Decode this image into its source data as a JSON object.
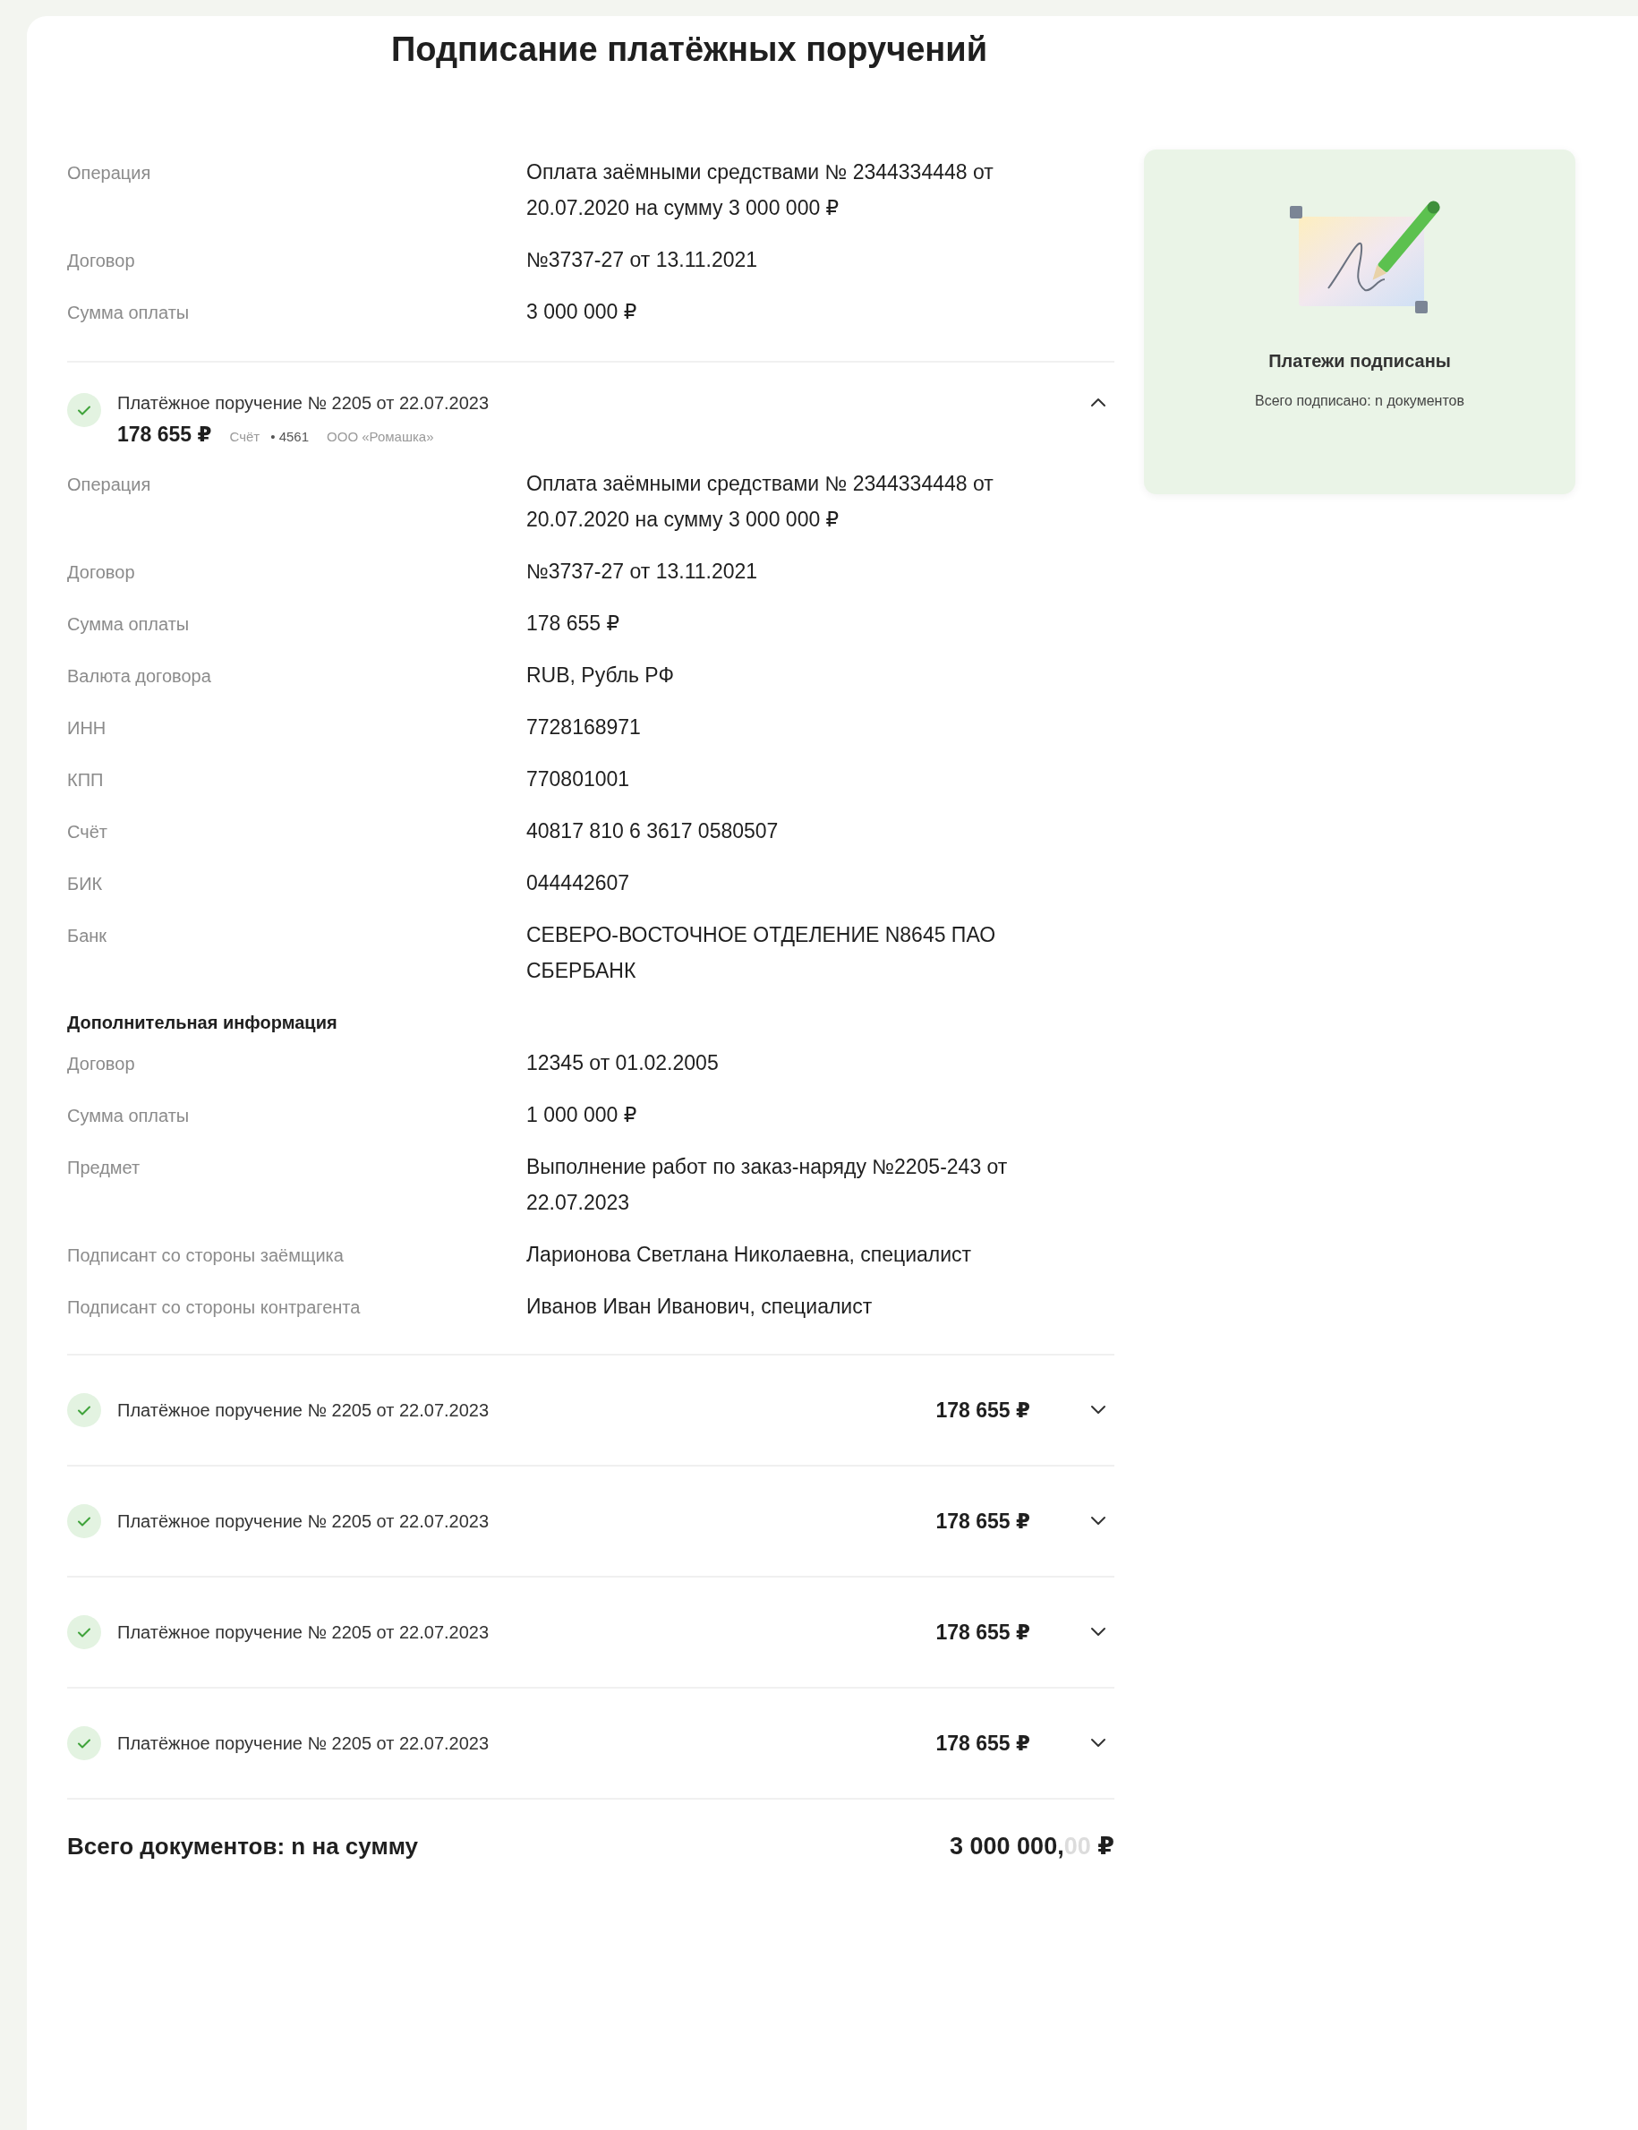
{
  "title": "Подписание платёжных поручений",
  "summary_fields": [
    {
      "label": "Операция",
      "value": "Оплата заёмными средствами № 2344334448 от 20.07.2020 на сумму 3 000 000 ₽"
    },
    {
      "label": "Договор",
      "value": "№3737-27 от 13.11.2021"
    },
    {
      "label": "Сумма оплаты",
      "value": "3 000 000 ₽"
    }
  ],
  "payments": [
    {
      "title": "Платёжное поручение № 2205 от 22.07.2023",
      "amount": "178 655 ₽",
      "signed": true,
      "expanded": true,
      "account": "Счёт",
      "account_number": "• 4561",
      "counterparty": "ООО «Ромашка»",
      "fields": [
        {
          "label": "Операция",
          "value": "Оплата заёмными средствами № 2344334448 от 20.07.2020 на сумму 3 000 000 ₽"
        },
        {
          "label": "Договор",
          "value": "№3737-27 от 13.11.2021"
        },
        {
          "label": "Сумма оплаты",
          "value": "178 655 ₽"
        },
        {
          "label": "Валюта договора",
          "value": "RUB, Рубль РФ"
        },
        {
          "label": "ИНН",
          "value": "7728168971"
        },
        {
          "label": "КПП",
          "value": "770801001"
        },
        {
          "label": "Счёт",
          "value": "40817 810 6 3617 0580507"
        },
        {
          "label": "БИК",
          "value": "044442607"
        },
        {
          "label": "Банк",
          "value": "СЕВЕРО-ВОСТОЧНОЕ ОТДЕЛЕНИЕ N8645 ПАО СБЕРБАНК"
        }
      ],
      "additional": {
        "title": "Дополнительная информация",
        "fields": [
          {
            "label": "Договор",
            "value": "12345 от 01.02.2005"
          },
          {
            "label": "Сумма оплаты",
            "value": "1 000 000 ₽"
          },
          {
            "label": "Предмет",
            "value": "Выполнение работ по заказ-наряду №2205-243 от 22.07.2023"
          },
          {
            "label": "Подписант со стороны заёмщика",
            "value": "Ларионова Светлана Николаевна, специалист"
          },
          {
            "label": "Подписант со стороны контрагента",
            "value": "Иванов Иван Иванович, специалист"
          }
        ]
      }
    },
    {
      "title": "Платёжное поручение № 2205 от 22.07.2023",
      "amount": "178 655 ₽",
      "signed": true,
      "expanded": false
    },
    {
      "title": "Платёжное поручение № 2205 от 22.07.2023",
      "amount": "178 655 ₽",
      "signed": true,
      "expanded": false
    },
    {
      "title": "Платёжное поручение № 2205 от 22.07.2023",
      "amount": "178 655 ₽",
      "signed": true,
      "expanded": false
    },
    {
      "title": "Платёжное поручение № 2205 от 22.07.2023",
      "amount": "178 655 ₽",
      "signed": true,
      "expanded": false
    }
  ],
  "total": {
    "label": "Всего документов: n на сумму",
    "integer": "3 000 000,",
    "fraction": "00",
    "currency": "₽"
  },
  "status_card": {
    "title": "Платежи подписаны",
    "subtitle": "Всего подписано: n документов"
  }
}
